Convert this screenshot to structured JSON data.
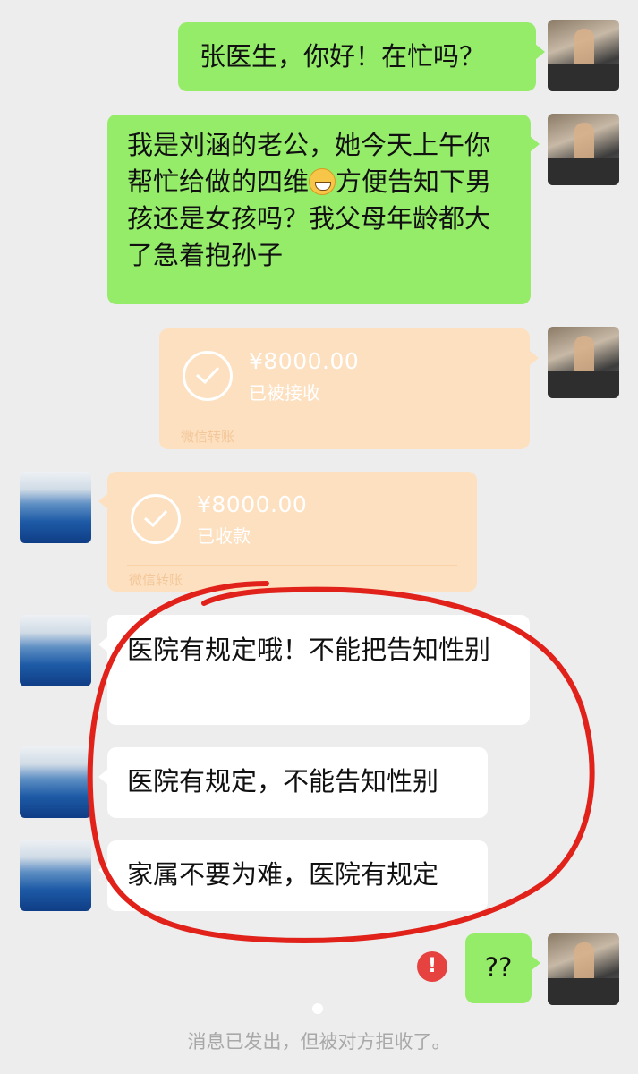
{
  "messages": {
    "m1": {
      "text": "张医生，你好！在忙吗？"
    },
    "m2": {
      "text_before": "我是刘涵的老公，她今天上午你帮忙给做的四维",
      "emoji": "grinning-emoji",
      "text_after": "方便告知下男孩还是女孩吗？我父母年龄都大了急着抱孙子"
    },
    "transfer_sent": {
      "amount": "¥8000.00",
      "status": "已被接收",
      "brand": "微信转账"
    },
    "transfer_received": {
      "amount": "¥8000.00",
      "status": "已收款",
      "brand": "微信转账"
    },
    "r1": {
      "text": "医院有规定哦！不能把告知性别"
    },
    "r2": {
      "text": "医院有规定，不能告知性别"
    },
    "r3": {
      "text": "家属不要为难，医院有规定"
    },
    "m_last": {
      "text": "??"
    }
  },
  "system_notice": "消息已发出，但被对方拒收了。",
  "icons": {
    "failed": "exclamation-icon",
    "transfer": "check-circle-icon"
  },
  "colors": {
    "background": "#ededed",
    "sent_bubble": "#95ec69",
    "received_bubble": "#ffffff",
    "transfer_bubble": "#fde0c0",
    "error": "#e64340",
    "annotation": "#e0221b"
  }
}
